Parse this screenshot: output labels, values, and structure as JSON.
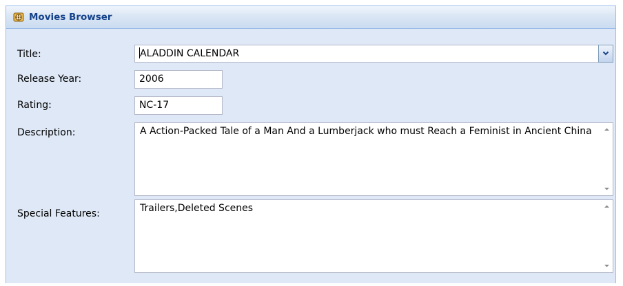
{
  "panel": {
    "title": "Movies Browser",
    "icon": "film-reel-icon"
  },
  "form": {
    "title_label": "Title:",
    "title_value": "ALADDIN CALENDAR",
    "year_label": "Release Year:",
    "year_value": "2006",
    "rating_label": "Rating:",
    "rating_value": "NC-17",
    "description_label": "Description:",
    "description_value": "A Action-Packed Tale of a Man And a Lumberjack who must Reach a Feminist in Ancient China",
    "features_label": "Special Features:",
    "features_value": "Trailers,Deleted Scenes"
  },
  "colors": {
    "panel_body": "#dfe8f6",
    "header_text": "#15428b",
    "panel_border": "#99bbe8",
    "field_border": "#b5b8c8"
  }
}
